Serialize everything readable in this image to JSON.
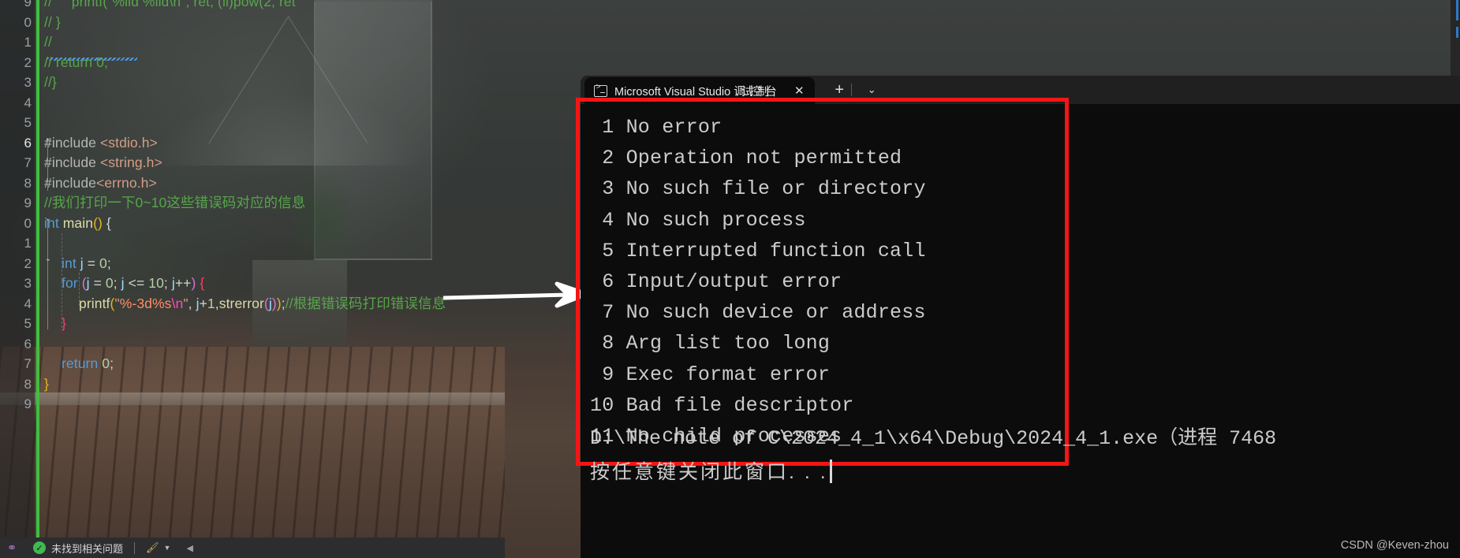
{
  "editor": {
    "gutter_lines": [
      "9",
      "0",
      "1",
      "2",
      "3",
      "4",
      "5",
      "6",
      "7",
      "8",
      "9",
      "0",
      "1",
      "2",
      "3",
      "4",
      "5",
      "6",
      "7",
      "8",
      "9"
    ],
    "code_lines": [
      {
        "indent": 0,
        "tokens": [
          {
            "t": "// ",
            "c": "cm"
          },
          {
            "t": "    printf(\"%lld %lld\\n\", ret, (ll)pow(2, ret",
            "c": "cm"
          }
        ]
      },
      {
        "indent": 0,
        "tokens": [
          {
            "t": "// }",
            "c": "cm"
          }
        ]
      },
      {
        "indent": 0,
        "tokens": [
          {
            "t": "//",
            "c": "cm"
          }
        ]
      },
      {
        "indent": 0,
        "tokens": [
          {
            "t": "// return 0;",
            "c": "cm"
          }
        ]
      },
      {
        "indent": 0,
        "tokens": [
          {
            "t": "//}",
            "c": "cm"
          }
        ]
      },
      {
        "indent": 0,
        "tokens": []
      },
      {
        "indent": 0,
        "tokens": []
      },
      {
        "indent": 0,
        "tokens": [
          {
            "t": "#include ",
            "c": "pp"
          },
          {
            "t": "<stdio.h>",
            "c": "hdr"
          }
        ]
      },
      {
        "indent": 0,
        "tokens": [
          {
            "t": "#include ",
            "c": "pp"
          },
          {
            "t": "<string.h>",
            "c": "hdr"
          }
        ]
      },
      {
        "indent": 0,
        "tokens": [
          {
            "t": "#include",
            "c": "pp"
          },
          {
            "t": "<errno.h>",
            "c": "hdr"
          }
        ]
      },
      {
        "indent": 0,
        "tokens": [
          {
            "t": "//我们打印一下0~10这些错误码对应的信息",
            "c": "cm"
          }
        ]
      },
      {
        "indent": 0,
        "tokens": [
          {
            "t": "int ",
            "c": "kw"
          },
          {
            "t": "main",
            "c": "fn"
          },
          {
            "t": "()",
            "c": "pr1"
          },
          {
            "t": " {",
            "c": "op"
          }
        ]
      },
      {
        "indent": 0,
        "tokens": []
      },
      {
        "indent": 1,
        "tokens": [
          {
            "t": "int ",
            "c": "kw"
          },
          {
            "t": "j",
            "c": "id"
          },
          {
            "t": " = ",
            "c": "op"
          },
          {
            "t": "0",
            "c": "num"
          },
          {
            "t": ";",
            "c": "op"
          }
        ]
      },
      {
        "indent": 1,
        "tokens": [
          {
            "t": "for ",
            "c": "kw"
          },
          {
            "t": "(",
            "c": "pr2"
          },
          {
            "t": "j",
            "c": "id"
          },
          {
            "t": " = ",
            "c": "op"
          },
          {
            "t": "0",
            "c": "num"
          },
          {
            "t": "; ",
            "c": "op"
          },
          {
            "t": "j",
            "c": "id"
          },
          {
            "t": " <= ",
            "c": "op"
          },
          {
            "t": "10",
            "c": "num"
          },
          {
            "t": "; ",
            "c": "op"
          },
          {
            "t": "j",
            "c": "id"
          },
          {
            "t": "++",
            "c": "op"
          },
          {
            "t": ")",
            "c": "pr2"
          },
          {
            "t": " {",
            "c": "pr3"
          }
        ]
      },
      {
        "indent": 2,
        "tokens": [
          {
            "t": "printf",
            "c": "fn"
          },
          {
            "t": "(",
            "c": "pr1"
          },
          {
            "t": "\"",
            "c": "str"
          },
          {
            "t": "%-3d%s",
            "c": "pct"
          },
          {
            "t": "\\n",
            "c": "esc"
          },
          {
            "t": "\"",
            "c": "str"
          },
          {
            "t": ", ",
            "c": "op"
          },
          {
            "t": "j",
            "c": "id"
          },
          {
            "t": "+",
            "c": "op"
          },
          {
            "t": "1",
            "c": "num"
          },
          {
            "t": ",",
            "c": "op"
          },
          {
            "t": "strerror",
            "c": "fn"
          },
          {
            "t": "(",
            "c": "pr2"
          },
          {
            "t": "j",
            "c": "id"
          },
          {
            "t": ")",
            "c": "pr2"
          },
          {
            "t": ")",
            "c": "pr1"
          },
          {
            "t": ";",
            "c": "op"
          },
          {
            "t": "//根据错误码打印错误信息",
            "c": "cm"
          }
        ]
      },
      {
        "indent": 1,
        "tokens": [
          {
            "t": "}",
            "c": "pr3"
          }
        ]
      },
      {
        "indent": 0,
        "tokens": []
      },
      {
        "indent": 1,
        "tokens": [
          {
            "t": "return ",
            "c": "kw"
          },
          {
            "t": "0",
            "c": "num"
          },
          {
            "t": ";",
            "c": "op"
          }
        ]
      },
      {
        "indent": 0,
        "tokens": [
          {
            "t": "}",
            "c": "pr1"
          }
        ]
      }
    ]
  },
  "statusbar": {
    "problems_text": "未找到相关问题",
    "ok_glyph": "✓",
    "brush_glyph": "🖌",
    "caret_glyph": "▼",
    "tri_glyph": "◀"
  },
  "console": {
    "tab": {
      "title_ascii": "Microsoft Visual Studio ",
      "title_cjk": "调试控制台",
      "close_glyph": "✕",
      "new_tab_glyph": "+",
      "dropdown_glyph": "⌄"
    },
    "errors": [
      {
        "code": "1",
        "message": "No error"
      },
      {
        "code": "2",
        "message": "Operation not permitted"
      },
      {
        "code": "3",
        "message": "No such file or directory"
      },
      {
        "code": "4",
        "message": "No such process"
      },
      {
        "code": "5",
        "message": "Interrupted function call"
      },
      {
        "code": "6",
        "message": "Input/output error"
      },
      {
        "code": "7",
        "message": "No such device or address"
      },
      {
        "code": "8",
        "message": "Arg list too long"
      },
      {
        "code": "9",
        "message": "Exec format error"
      },
      {
        "code": "10",
        "message": "Bad file descriptor"
      },
      {
        "code": "11",
        "message": "No child processes"
      }
    ],
    "exit_line": "D:\\The note of C\\2024_4_1\\x64\\Debug\\2024_4_1.exe（进程 7468",
    "press_key_line": "按任意键关闭此窗口. . ."
  },
  "watermark": {
    "text": "CSDN @Keven-zhou"
  },
  "colors": {
    "error_box_border": "#f41515",
    "console_bg": "#0c0c0c",
    "tabbar_bg": "#202020",
    "change_bar": "#3ec13e",
    "arrow": "#ffffff"
  }
}
